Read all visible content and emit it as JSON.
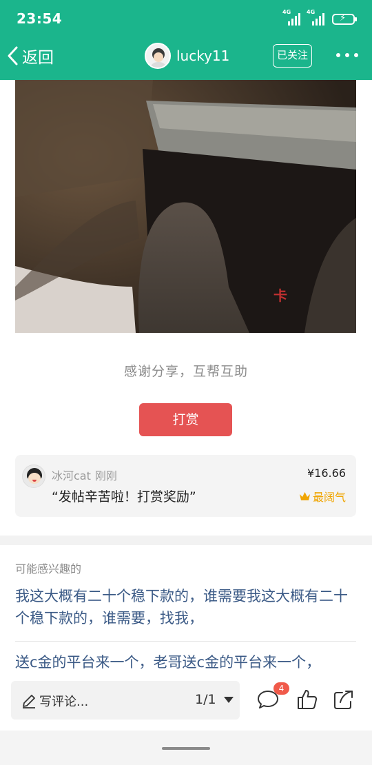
{
  "status_bar": {
    "time": "23:54",
    "signal_label_1": "4G",
    "signal_label_2": "4G"
  },
  "header": {
    "back_label": "返回",
    "username": "lucky11",
    "follow_label": "已关注"
  },
  "post": {
    "watermark": "卡",
    "thanks_text": "感谢分享，互帮互助",
    "tip_button_label": "打赏"
  },
  "tip_record": {
    "user": "冰河cat",
    "time": "刚刚",
    "message": "“发帖辛苦啦！打赏奖励”",
    "amount": "¥16.66",
    "badge": "最阔气"
  },
  "recommendations": {
    "title": "可能感兴趣的",
    "items": [
      "我这大概有二十个稳下款的，谁需要我这大概有二十个稳下款的，谁需要，找我，",
      "送c金的平台来一个，老哥送c金的平台来一个，"
    ]
  },
  "comment_bar": {
    "placeholder": "写评论...",
    "pages": "1/1",
    "comment_count": "4"
  },
  "colors": {
    "accent": "#1bb58c",
    "tip_button": "#e55353",
    "link": "#3b5a86",
    "badge": "#f0a500"
  }
}
